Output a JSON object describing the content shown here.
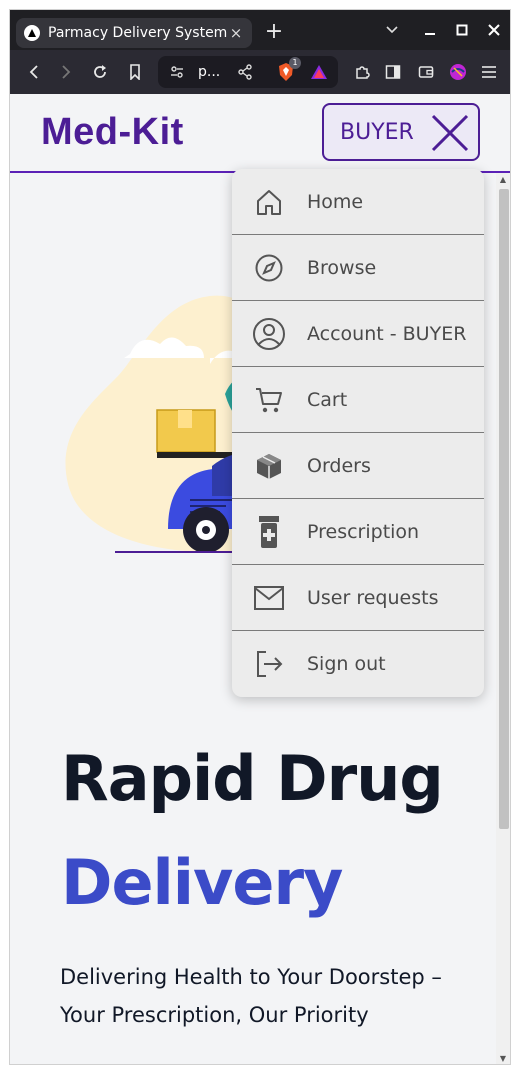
{
  "browser": {
    "tab_title": "Parmacy Delivery System",
    "tab_close": "×",
    "new_tab": "+",
    "url_text": "p...",
    "extension_badge": "1",
    "favicon_icon": "brave-triangle-icon"
  },
  "site": {
    "logo": "Med-Kit",
    "role_button_label": "BUYER"
  },
  "menu": {
    "items": [
      {
        "label": "Home",
        "icon": "home-icon"
      },
      {
        "label": "Browse",
        "icon": "compass-icon"
      },
      {
        "label": "Account - BUYER",
        "icon": "account-circle-icon"
      },
      {
        "label": "Cart",
        "icon": "cart-icon"
      },
      {
        "label": "Orders",
        "icon": "package-icon"
      },
      {
        "label": "Prescription",
        "icon": "medicine-bottle-icon"
      },
      {
        "label": "User requests",
        "icon": "mail-icon"
      },
      {
        "label": "Sign out",
        "icon": "sign-out-icon"
      }
    ]
  },
  "hero": {
    "title_line1": "Rapid Drug",
    "title_line2": "Delivery",
    "subtitle": "Delivering Health to Your Doorstep – Your Prescription, Our Priority"
  },
  "colors": {
    "brand": "#4c1d95",
    "accent_blue": "#3b4bc8",
    "page_bg": "#f3f4f6",
    "menu_bg": "#ececec"
  }
}
